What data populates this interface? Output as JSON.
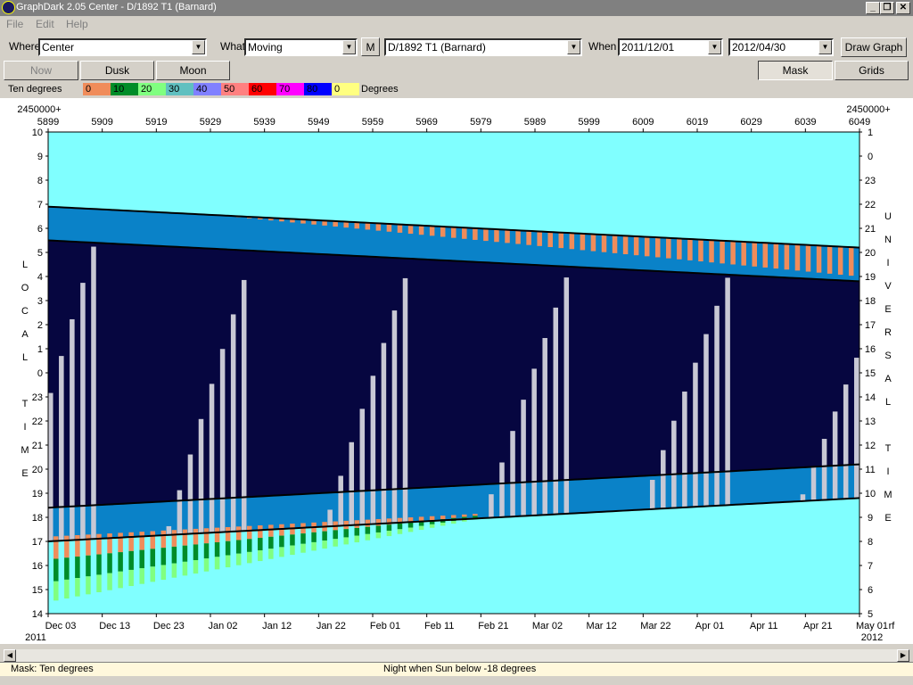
{
  "window": {
    "title": "GraphDark 2.05  Center  -  D/1892 T1 (Barnard)",
    "minimize": "_",
    "restore": "❐",
    "close": "✕"
  },
  "menu": [
    "File",
    "Edit",
    "Help"
  ],
  "toolbar": {
    "where_label": "Where",
    "where_value": "Center",
    "what_label": "What",
    "what_value": "Moving",
    "m_button": "M",
    "object_value": "D/1892 T1 (Barnard)",
    "when_label": "When",
    "start_date": "2011/12/01",
    "end_date": "2012/04/30",
    "draw_button": "Draw Graph"
  },
  "toolbar2": {
    "now": "Now",
    "dusk": "Dusk",
    "moon": "Moon",
    "mask": "Mask",
    "grids": "Grids"
  },
  "legend": {
    "title": "Ten degrees",
    "units": "Degrees",
    "entries": [
      {
        "label": "0",
        "color": "#f08c5a"
      },
      {
        "label": "10",
        "color": "#008c28"
      },
      {
        "label": "20",
        "color": "#80ff80"
      },
      {
        "label": "30",
        "color": "#60c0c0"
      },
      {
        "label": "40",
        "color": "#8080ff"
      },
      {
        "label": "50",
        "color": "#ff8080"
      },
      {
        "label": "60",
        "color": "#ff0000"
      },
      {
        "label": "70",
        "color": "#ff00ff"
      },
      {
        "label": "80",
        "color": "#0000ff"
      },
      {
        "label": "0",
        "color": "#ffff80"
      }
    ]
  },
  "chart_data": {
    "type": "heatmap",
    "jd_prefix_left": "2450000+",
    "jd_prefix_right": "2450000+",
    "jd_ticks": [
      "5899",
      "5909",
      "5919",
      "5929",
      "5939",
      "5949",
      "5959",
      "5969",
      "5979",
      "5989",
      "5999",
      "6009",
      "6019",
      "6029",
      "6039",
      "6049"
    ],
    "local_time_ticks": [
      "10",
      "9",
      "8",
      "7",
      "6",
      "5",
      "4",
      "3",
      "2",
      "1",
      "0",
      "23",
      "22",
      "21",
      "20",
      "19",
      "18",
      "17",
      "16",
      "15",
      "14"
    ],
    "ut_ticks": [
      "1",
      "0",
      "23",
      "22",
      "21",
      "20",
      "19",
      "18",
      "17",
      "16",
      "15",
      "14",
      "13",
      "12",
      "11",
      "10",
      "9",
      "8",
      "7",
      "6",
      "5"
    ],
    "date_ticks": [
      "Dec 03",
      "Dec 13",
      "Dec 23",
      "Jan 02",
      "Jan 12",
      "Jan 22",
      "Feb 01",
      "Feb 11",
      "Feb 21",
      "Mar 02",
      "Mar 12",
      "Mar 22",
      "Apr 01",
      "Apr 11",
      "Apr 21",
      "May 01"
    ],
    "year_left": "2011",
    "year_right": "2012",
    "x_end_label": "rf",
    "left_axis_label": [
      "L",
      "O",
      "C",
      "A",
      "L",
      "",
      "T",
      "I",
      "M",
      "E"
    ],
    "right_axis_label": [
      "U",
      "N",
      "I",
      "V",
      "E",
      "R",
      "S",
      "A",
      "L",
      "",
      "T",
      "I",
      "M",
      "E"
    ],
    "dawn_start": 6.9,
    "dawn_end": 5.2,
    "dusk_start": 17.0,
    "dusk_end": 18.8,
    "colors": {
      "day": "#80ffff",
      "night": "#060640",
      "moon": "#c8c8d4",
      "twilight": "#0a82c8"
    }
  },
  "status": {
    "mask": "Mask:  Ten degrees",
    "night": "Night when Sun below -18 degrees"
  }
}
